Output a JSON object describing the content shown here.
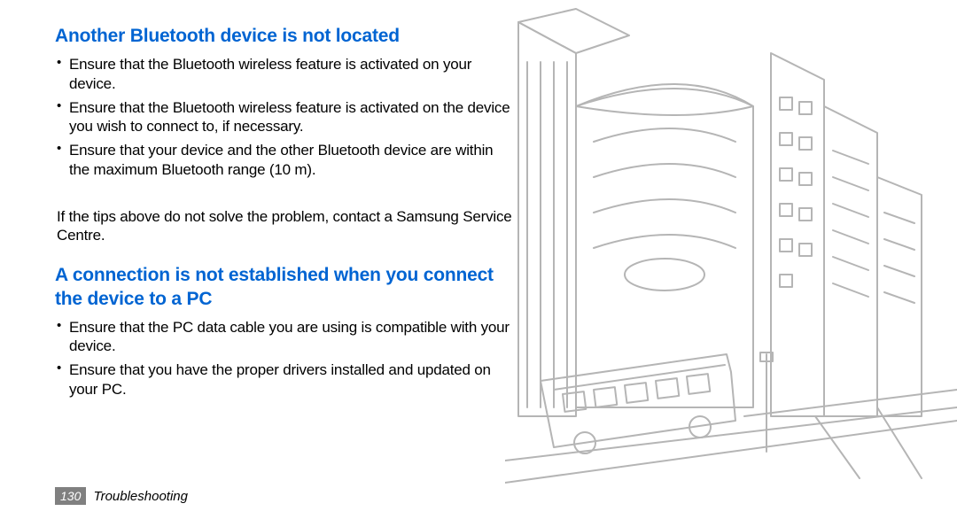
{
  "heading1": "Another Bluetooth device is not located",
  "bullets1": [
    "Ensure that the Bluetooth wireless feature is activated on your device.",
    "Ensure that the Bluetooth wireless feature is activated on the device you wish to connect to, if necessary.",
    "Ensure that your device and the other Bluetooth device are within the maximum Bluetooth range (10 m)."
  ],
  "para1": "If the tips above do not solve the problem, contact a Samsung Service Centre.",
  "heading2": "A connection is not established when you connect the device to a PC",
  "bullets2": [
    "Ensure that the PC data cable you are using is compatible with your device.",
    "Ensure that you have the proper drivers installed and updated on your PC."
  ],
  "footer": {
    "page": "130",
    "section": "Troubleshooting"
  },
  "art_label": "cityscape-illustration"
}
